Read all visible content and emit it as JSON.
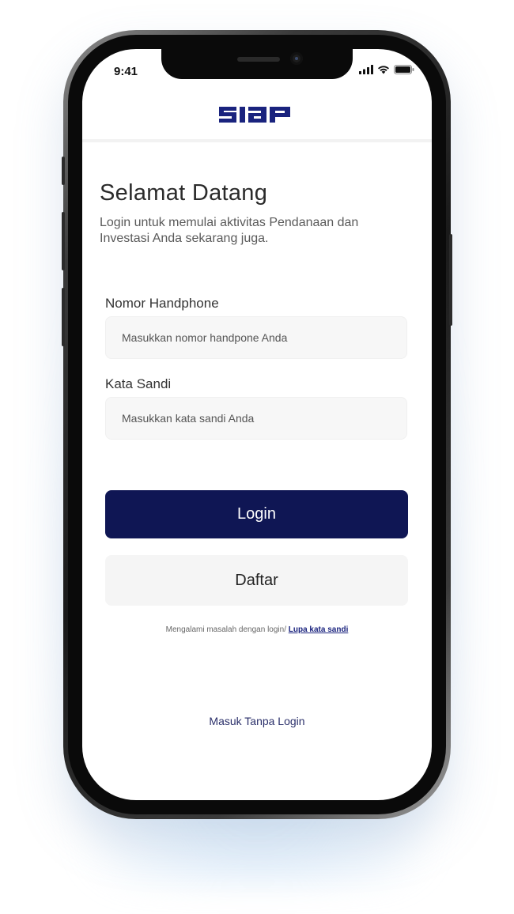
{
  "status_bar": {
    "time": "9:41"
  },
  "header": {
    "logo_text": "siap",
    "logo_color": "#1a237e"
  },
  "welcome": {
    "title": "Selamat Datang",
    "subtitle": "Login untuk memulai aktivitas Pendanaan dan Investasi Anda sekarang juga."
  },
  "form": {
    "phone_label": "Nomor Handphone",
    "phone_placeholder": "Masukkan nomor handpone Anda",
    "password_label": "Kata Sandi",
    "password_placeholder": "Masukkan kata sandi Anda"
  },
  "actions": {
    "login_label": "Login",
    "register_label": "Daftar",
    "help_text": "Mengalami masalah dengan login/ ",
    "forgot_link": "Lupa kata sandi",
    "guest_label": "Masuk Tanpa Login"
  },
  "colors": {
    "primary": "#0f1654",
    "secondary_button": "#f5f5f5",
    "input_background": "#f7f7f7"
  }
}
